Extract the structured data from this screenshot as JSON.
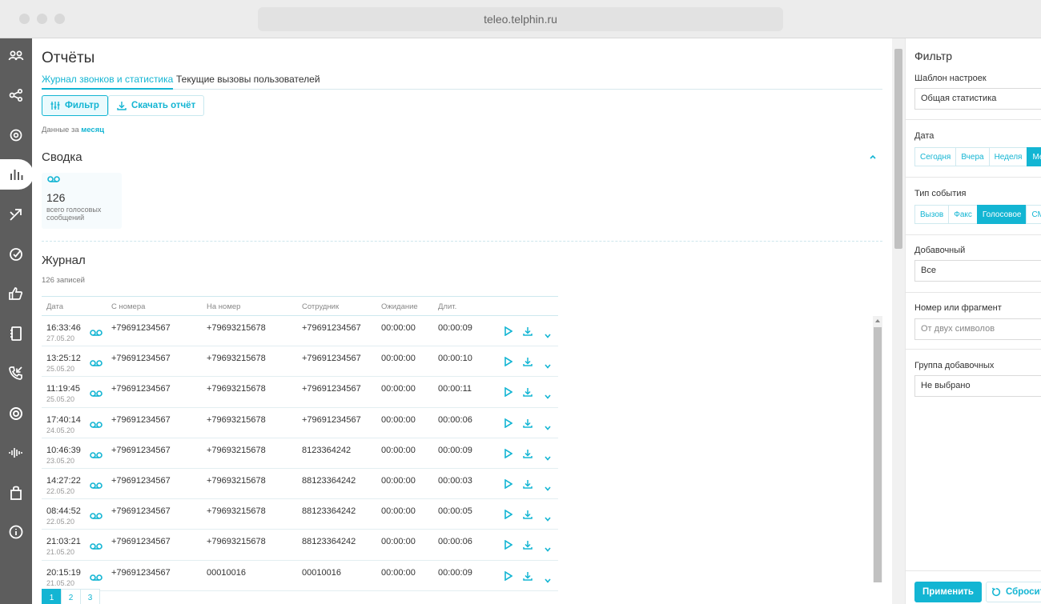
{
  "browser": {
    "url": "teleo.telphin.ru"
  },
  "sidebar": {
    "items": [
      {
        "name": "users-icon"
      },
      {
        "name": "network-icon"
      },
      {
        "name": "settings-icon"
      },
      {
        "name": "reports-icon",
        "active": true
      },
      {
        "name": "routing-icon"
      },
      {
        "name": "target-icon"
      },
      {
        "name": "thumbs-up-icon"
      },
      {
        "name": "contacts-book-icon"
      },
      {
        "name": "phone-callback-icon"
      },
      {
        "name": "ring-icon"
      },
      {
        "name": "sound-wave-icon"
      },
      {
        "name": "shopping-bag-icon"
      },
      {
        "name": "info-icon"
      }
    ]
  },
  "page": {
    "title": "Отчёты",
    "tabs": [
      "Журнал звонков и статистика",
      "Текущие вызовы пользователей"
    ],
    "filter_button": "Фильтр",
    "download_button": "Скачать отчёт",
    "period_prefix": "Данные за",
    "period_value": "месяц"
  },
  "summary": {
    "title": "Сводка",
    "count": "126",
    "label": "всего голосовых сообщений"
  },
  "journal": {
    "title": "Журнал",
    "records": "126 записей",
    "columns": [
      "Дата",
      "С номера",
      "На номер",
      "Сотрудник",
      "Ожидание",
      "Длит."
    ],
    "rows": [
      {
        "time": "16:33:46",
        "date": "27.05.20",
        "from": "+79691234567",
        "to": "+79693215678",
        "employee": "+79691234567",
        "wait": "00:00:00",
        "dur": "00:00:09"
      },
      {
        "time": "13:25:12",
        "date": "25.05.20",
        "from": "+79691234567",
        "to": "+79693215678",
        "employee": "+79691234567",
        "wait": "00:00:00",
        "dur": "00:00:10"
      },
      {
        "time": "11:19:45",
        "date": "25.05.20",
        "from": "+79691234567",
        "to": "+79693215678",
        "employee": "+79691234567",
        "wait": "00:00:00",
        "dur": "00:00:11"
      },
      {
        "time": "17:40:14",
        "date": "24.05.20",
        "from": "+79691234567",
        "to": "+79693215678",
        "employee": "+79691234567",
        "wait": "00:00:00",
        "dur": "00:00:06"
      },
      {
        "time": "10:46:39",
        "date": "23.05.20",
        "from": "+79691234567",
        "to": "+79693215678",
        "employee": "8123364242",
        "wait": "00:00:00",
        "dur": "00:00:09"
      },
      {
        "time": "14:27:22",
        "date": "22.05.20",
        "from": "+79691234567",
        "to": "+79693215678",
        "employee": "88123364242",
        "wait": "00:00:00",
        "dur": "00:00:03"
      },
      {
        "time": "08:44:52",
        "date": "22.05.20",
        "from": "+79691234567",
        "to": "+79693215678",
        "employee": "88123364242",
        "wait": "00:00:00",
        "dur": "00:00:05"
      },
      {
        "time": "21:03:21",
        "date": "21.05.20",
        "from": "+79691234567",
        "to": "+79693215678",
        "employee": "88123364242",
        "wait": "00:00:00",
        "dur": "00:00:06"
      },
      {
        "time": "20:15:19",
        "date": "21.05.20",
        "from": "+79691234567",
        "to": "00010016",
        "employee": "00010016",
        "wait": "00:00:00",
        "dur": "00:00:09"
      }
    ],
    "pages": [
      "1",
      "2",
      "3"
    ]
  },
  "filter": {
    "title": "Фильтр",
    "template_label": "Шаблон настроек",
    "template_value": "Общая статистика",
    "date_label": "Дата",
    "date_options": [
      "Сегодня",
      "Вчера",
      "Неделя",
      "Мес"
    ],
    "event_label": "Тип события",
    "event_options": [
      "Вызов",
      "Факс",
      "Голосовое",
      "СМ"
    ],
    "extension_label": "Добавочный",
    "extension_value": "Все",
    "number_label": "Номер или фрагмент",
    "number_placeholder": "От двух символов",
    "group_label": "Группа добавочных",
    "group_value": "Не выбрано",
    "apply": "Применить",
    "reset": "Сбросит"
  },
  "colors": {
    "accent": "#13b5d3",
    "sidebar": "#5d5d5d"
  }
}
